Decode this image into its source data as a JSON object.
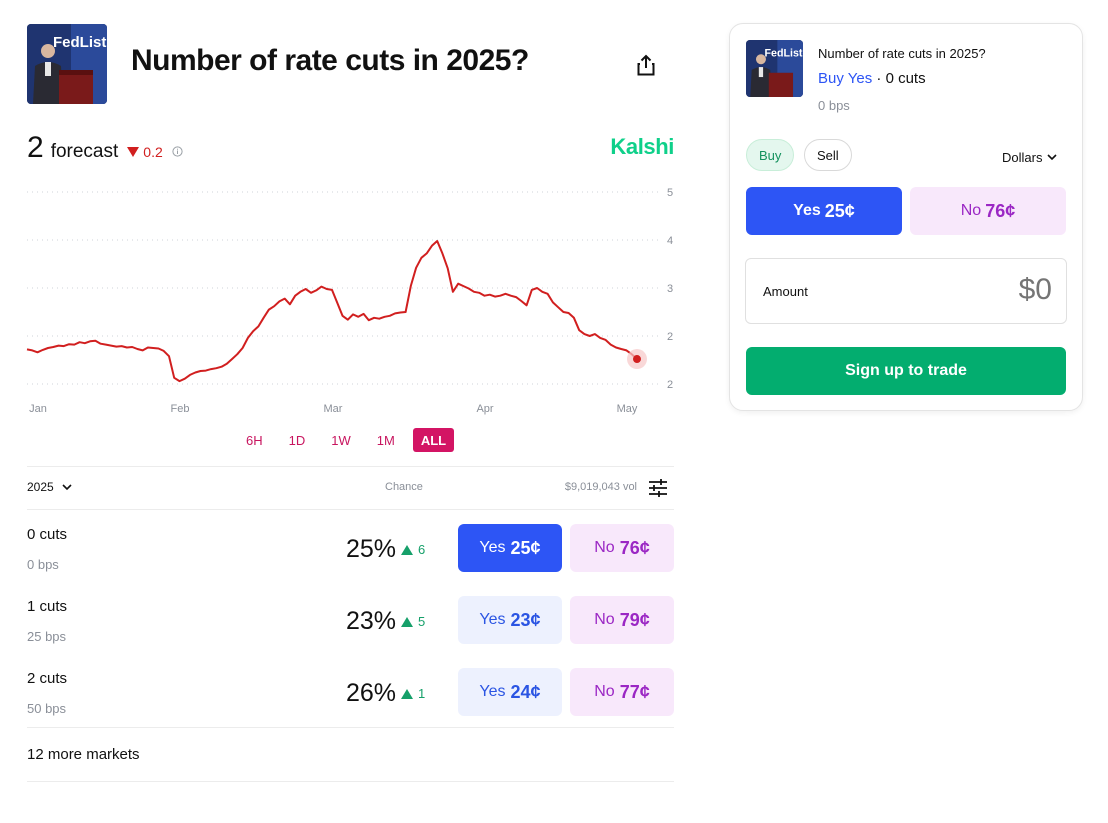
{
  "market": {
    "title": "Number of rate cuts in 2025?",
    "forecast_value": "2",
    "forecast_label": "forecast",
    "forecast_change": "0.2",
    "brand": "Kalshi"
  },
  "chart_data": {
    "type": "line",
    "x_labels": [
      "Jan",
      "Feb",
      "Mar",
      "Apr",
      "May"
    ],
    "y_ticks": [
      "5",
      "4",
      "3",
      "2",
      "2"
    ],
    "ylim": [
      1,
      5
    ],
    "grid": true,
    "line_color": "#d11f1f",
    "series": [
      {
        "values": [
          1.72,
          1.7,
          1.66,
          1.71,
          1.75,
          1.77,
          1.8,
          1.79,
          1.83,
          1.82,
          1.87,
          1.85,
          1.89,
          1.9,
          1.84,
          1.82,
          1.8,
          1.78,
          1.79,
          1.76,
          1.77,
          1.73,
          1.7,
          1.76,
          1.75,
          1.74,
          1.69,
          1.58,
          1.13,
          1.06,
          1.11,
          1.19,
          1.24,
          1.27,
          1.28,
          1.31,
          1.33,
          1.36,
          1.42,
          1.52,
          1.62,
          1.75,
          1.96,
          2.1,
          2.2,
          2.38,
          2.55,
          2.62,
          2.72,
          2.78,
          2.66,
          2.84,
          2.92,
          2.98,
          2.9,
          2.95,
          3.03,
          2.98,
          2.96,
          2.69,
          2.42,
          2.34,
          2.45,
          2.4,
          2.46,
          2.33,
          2.38,
          2.36,
          2.4,
          2.42,
          2.47,
          2.49,
          2.5,
          3.05,
          3.42,
          3.63,
          3.72,
          3.88,
          3.98,
          3.72,
          3.41,
          2.92,
          3.09,
          3.04,
          2.99,
          2.92,
          2.9,
          2.84,
          2.86,
          2.82,
          2.84,
          2.88,
          2.84,
          2.81,
          2.73,
          2.64,
          2.96,
          3.0,
          2.92,
          2.88,
          2.7,
          2.6,
          2.5,
          2.48,
          2.38,
          2.12,
          2.04,
          2.0,
          2.04,
          1.96,
          1.92,
          1.82,
          1.76,
          1.73,
          1.7,
          1.62,
          1.52
        ]
      }
    ]
  },
  "time_ranges": [
    "6H",
    "1D",
    "1W",
    "1M",
    "ALL"
  ],
  "active_range": "ALL",
  "table": {
    "year": "2025",
    "chance_header": "Chance",
    "volume": "$9,019,043 vol",
    "rows": [
      {
        "name": "0 cuts",
        "sub": "0 bps",
        "chance": "25%",
        "delta": "6",
        "yes_label": "Yes",
        "yes_price": "25¢",
        "no_label": "No",
        "no_price": "76¢"
      },
      {
        "name": "1 cuts",
        "sub": "25 bps",
        "chance": "23%",
        "delta": "5",
        "yes_label": "Yes",
        "yes_price": "23¢",
        "no_label": "No",
        "no_price": "79¢"
      },
      {
        "name": "2 cuts",
        "sub": "50 bps",
        "chance": "26%",
        "delta": "1",
        "yes_label": "Yes",
        "yes_price": "24¢",
        "no_label": "No",
        "no_price": "77¢"
      }
    ],
    "more_markets": "12 more markets"
  },
  "trade_panel": {
    "title": "Number of rate cuts in 2025?",
    "selection_side": "Buy Yes",
    "selection_sep": " · ",
    "selection_market": "0 cuts",
    "bps": "0 bps",
    "buy_label": "Buy",
    "sell_label": "Sell",
    "currency": "Dollars",
    "yes_label": "Yes",
    "yes_price": "25¢",
    "no_label": "No",
    "no_price": "76¢",
    "amount_label": "Amount",
    "amount_placeholder": "$0",
    "signup_label": "Sign up to trade"
  },
  "thumbnail_text": "FedListen",
  "colors": {
    "accent_green": "#0fd08a",
    "yes_blue": "#2d55f5",
    "no_purple": "#9b27c4",
    "range_pink": "#d31464",
    "down_red": "#d11f1f",
    "cta_green": "#03ad6f"
  }
}
